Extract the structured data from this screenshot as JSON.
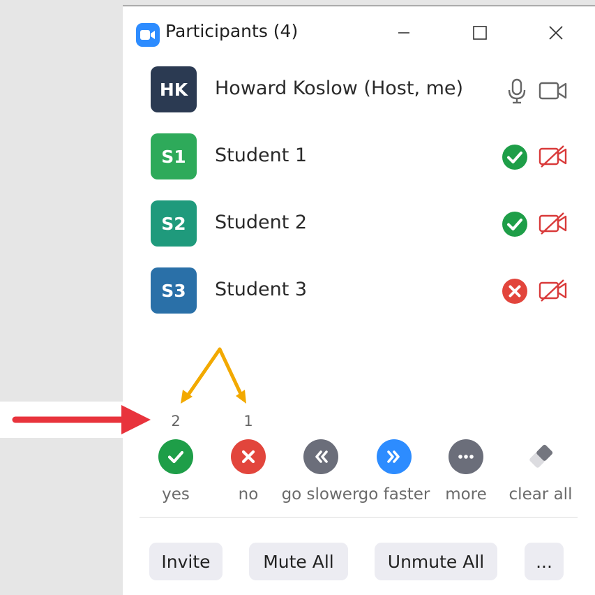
{
  "window": {
    "title": "Participants (4)",
    "controls": [
      "minimize",
      "maximize",
      "close"
    ]
  },
  "participants": [
    {
      "initials": "HK",
      "name": "Howard Koslow (Host, me)",
      "avatar_color": "#2b3a52",
      "status": "microphone",
      "video": "camera-on"
    },
    {
      "initials": "S1",
      "name": "Student 1",
      "avatar_color": "#2eaa5a",
      "status": "yes",
      "video": "camera-off"
    },
    {
      "initials": "S2",
      "name": "Student 2",
      "avatar_color": "#1f9a7c",
      "status": "yes",
      "video": "camera-off"
    },
    {
      "initials": "S3",
      "name": "Student 3",
      "avatar_color": "#2a70a8",
      "status": "no",
      "video": "camera-off"
    }
  ],
  "reactions": [
    {
      "label": "yes",
      "count": "2",
      "color": "#1e9e48",
      "icon": "check-icon"
    },
    {
      "label": "no",
      "count": "1",
      "color": "#e2453c",
      "icon": "x-icon"
    },
    {
      "label": "go slower",
      "count": "",
      "color": "#6b6e7a",
      "icon": "rewind-icon"
    },
    {
      "label": "go faster",
      "count": "",
      "color": "#2d8cff",
      "icon": "fast-forward-icon"
    },
    {
      "label": "more",
      "count": "",
      "color": "#6b6e7a",
      "icon": "more-icon"
    },
    {
      "label": "clear all",
      "count": "",
      "color": "#c8c8cc",
      "icon": "eraser-icon"
    }
  ],
  "footer": {
    "invite": "Invite",
    "mute_all": "Mute All",
    "unmute_all": "Unmute All",
    "more": "..."
  },
  "colors": {
    "yes": "#1e9e48",
    "no": "#e2453c",
    "camera_off": "#d93a3a",
    "annotation_arrow_red": "#e8333c",
    "annotation_arrow_orange": "#f2a900"
  }
}
